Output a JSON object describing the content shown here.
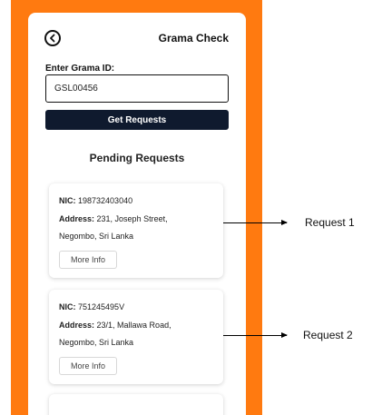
{
  "app": {
    "title": "Grama Check",
    "back_icon": "back-arrow-circle-icon"
  },
  "form": {
    "id_label": "Enter Grama ID:",
    "id_value": "GSL00456",
    "submit_label": "Get Requests"
  },
  "requests_section": {
    "title": "Pending Requests",
    "nic_label": "NIC:",
    "address_label": "Address:",
    "items": [
      {
        "nic": "198732403040",
        "address_line1": "231, Joseph Street,",
        "address_line2": "Negombo, Sri Lanka",
        "button_label": "More Info"
      },
      {
        "nic": "751245495V",
        "address_line1": "23/1, Mallawa Road,",
        "address_line2": "Negombo, Sri Lanka",
        "button_label": "More Info"
      }
    ]
  },
  "annotations": [
    "Request 1",
    "Request 2"
  ],
  "colors": {
    "frame": "#ff7a10",
    "button_dark": "#0f1a2e"
  }
}
